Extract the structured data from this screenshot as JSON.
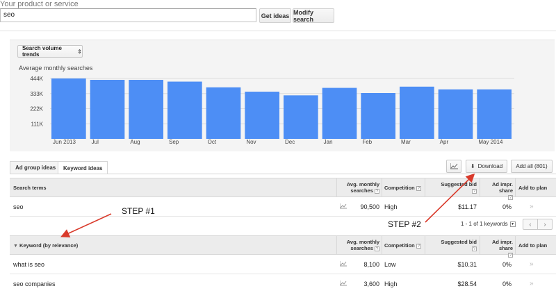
{
  "header": {
    "label": "Your product or service",
    "input_value": "seo",
    "get_ideas": "Get ideas",
    "modify_search": "Modify search"
  },
  "trends": {
    "dropdown_label": "Search volume trends",
    "chart_title": "Average monthly searches"
  },
  "chart_data": {
    "type": "bar",
    "title": "Average monthly searches",
    "categories": [
      "Jun 2013",
      "Jul",
      "Aug",
      "Sep",
      "Oct",
      "Nov",
      "Dec",
      "Jan",
      "Feb",
      "Mar",
      "Apr",
      "May 2014"
    ],
    "values": [
      444000,
      434000,
      434000,
      421000,
      379000,
      347000,
      320000,
      375000,
      337000,
      384000,
      364000,
      364000
    ],
    "yticks": [
      "111K",
      "222K",
      "333K",
      "444K"
    ],
    "ytick_values": [
      111000,
      222000,
      333000,
      444000
    ],
    "ylim": [
      0,
      480000
    ],
    "color": "#4d8ef5",
    "grid": true
  },
  "tabs": {
    "ad_group": "Ad group ideas",
    "keyword": "Keyword ideas"
  },
  "toolbar": {
    "download": "Download",
    "add_all": "Add all (801)"
  },
  "search_terms_table": {
    "col_term": "Search terms",
    "col_avg_1": "Avg. monthly",
    "col_avg_2": "searches",
    "col_comp": "Competition",
    "col_bid": "Suggested bid",
    "col_share": "Ad impr. share",
    "col_add": "Add to plan",
    "rows": [
      {
        "term": "seo",
        "avg": "90,500",
        "competition": "High",
        "bid": "$11.17",
        "share": "0%"
      }
    ]
  },
  "pager": {
    "text": "1 - 1 of 1 keywords",
    "prev": "‹",
    "next": "›"
  },
  "keyword_table": {
    "col_term": "Keyword (by relevance)",
    "col_avg_1": "Avg. monthly",
    "col_avg_2": "searches",
    "col_comp": "Competition",
    "col_bid": "Suggested bid",
    "col_share": "Ad impr. share",
    "col_add": "Add to plan",
    "rows": [
      {
        "term": "what is seo",
        "avg": "8,100",
        "competition": "Low",
        "bid": "$10.31",
        "share": "0%"
      },
      {
        "term": "seo companies",
        "avg": "3,600",
        "competition": "High",
        "bid": "$28.54",
        "share": "0%"
      }
    ]
  },
  "annotations": {
    "step1": "STEP #1",
    "step2": "STEP #2",
    "arrow_color": "#d93a2b"
  },
  "icons": {
    "question": "?",
    "chevron": "»",
    "sort_down": "▼",
    "updown": "⇕",
    "download_glyph": "⬇"
  }
}
